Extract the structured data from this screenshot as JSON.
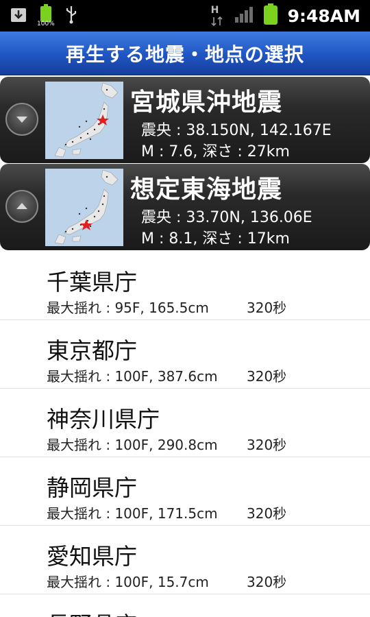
{
  "status_bar": {
    "time": "9:48AM",
    "battery_mini_label": "100%",
    "network_label": "H",
    "icons": [
      "download-icon",
      "battery-full-icon",
      "usb-icon",
      "hsdpa-data-icon",
      "signal-icon",
      "battery-icon"
    ]
  },
  "title": "再生する地震・地点の選択",
  "quakes": [
    {
      "name": "宮城県沖地震",
      "epicenter": "震央 : 38.150N, 142.167E",
      "magnitude": "M : 7.6, 深さ : 27km",
      "toggle": "collapse",
      "toggle_icon": "chevron-down-icon"
    },
    {
      "name": "想定東海地震",
      "epicenter": "震央 : 33.70N, 136.06E",
      "magnitude": "M : 8.1, 深さ : 17km",
      "toggle": "expand",
      "toggle_icon": "chevron-up-icon"
    }
  ],
  "locations": [
    {
      "name": "千葉県庁",
      "detail": "最大揺れ : 95F, 165.5cm",
      "seconds": "320秒"
    },
    {
      "name": "東京都庁",
      "detail": "最大揺れ : 100F, 387.6cm",
      "seconds": "320秒"
    },
    {
      "name": "神奈川県庁",
      "detail": "最大揺れ : 100F, 290.8cm",
      "seconds": "320秒"
    },
    {
      "name": "静岡県庁",
      "detail": "最大揺れ : 100F, 171.5cm",
      "seconds": "320秒"
    },
    {
      "name": "愛知県庁",
      "detail": "最大揺れ : 100F, 15.7cm",
      "seconds": "320秒"
    },
    {
      "name": "長野県庁",
      "detail": "",
      "seconds": ""
    }
  ],
  "colors": {
    "title_bar": "#1f55c3",
    "card_bg": "#2a2a2a",
    "epicenter_star": "#e02020"
  }
}
